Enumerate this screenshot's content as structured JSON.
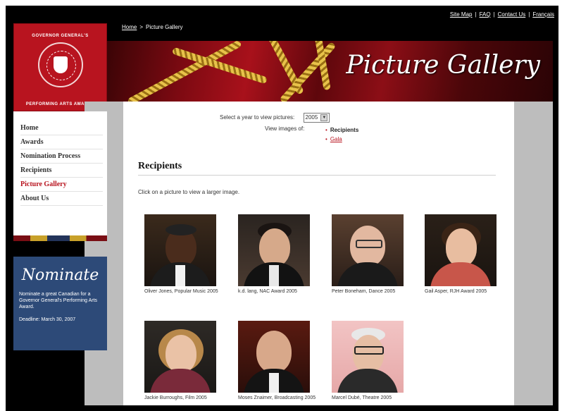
{
  "top_links": [
    "Site Map",
    "FAQ",
    "Contact Us",
    "Français"
  ],
  "top_link_separator": "|",
  "breadcrumb": {
    "home": "Home",
    "arrow": ">",
    "current": "Picture Gallery"
  },
  "logo": {
    "line1": "GOVERNOR GENERAL'S",
    "line2": "PERFORMING ARTS AWARDS"
  },
  "banner": {
    "title": "Picture Gallery"
  },
  "nav": {
    "items": [
      {
        "label": "Home",
        "active": false
      },
      {
        "label": "Awards",
        "active": false
      },
      {
        "label": "Nomination Process",
        "active": false
      },
      {
        "label": "Recipients",
        "active": false
      },
      {
        "label": "Picture Gallery",
        "active": true
      },
      {
        "label": "About Us",
        "active": false
      }
    ]
  },
  "nominate": {
    "title": "Nominate",
    "text": "Nominate a great Canadian for a Governor General's Performing Arts Award.",
    "deadline": "Deadline: March 30, 2007"
  },
  "selector": {
    "label": "Select a year to view pictures:",
    "value": "2005"
  },
  "view_images": {
    "label": "View images of:",
    "options": [
      "Recipients",
      "Gala"
    ],
    "bullet": "•"
  },
  "section": {
    "heading": "Recipients",
    "instruction": "Click on a picture to view a larger image."
  },
  "photos": [
    {
      "caption": "Oliver Jones, Popular Music 2005"
    },
    {
      "caption": "k.d. lang, NAC Award 2005"
    },
    {
      "caption": "Peter Boneham, Dance 2005"
    },
    {
      "caption": "Gail Asper, RJH Award 2005"
    },
    {
      "caption": "Jackie Burroughs, Film 2005"
    },
    {
      "caption": "Moses Znaimer, Broadcasting 2005"
    },
    {
      "caption": "Marcel Dubé, Theatre 2005"
    }
  ],
  "colors": {
    "brand_red": "#b8141f",
    "nav_blue": "#2d4a78",
    "page_black": "#000000",
    "band_gray": "#bdbdbd"
  },
  "icons": [
    "seal-icon",
    "dropdown-arrow-icon",
    "bullet-icon"
  ]
}
